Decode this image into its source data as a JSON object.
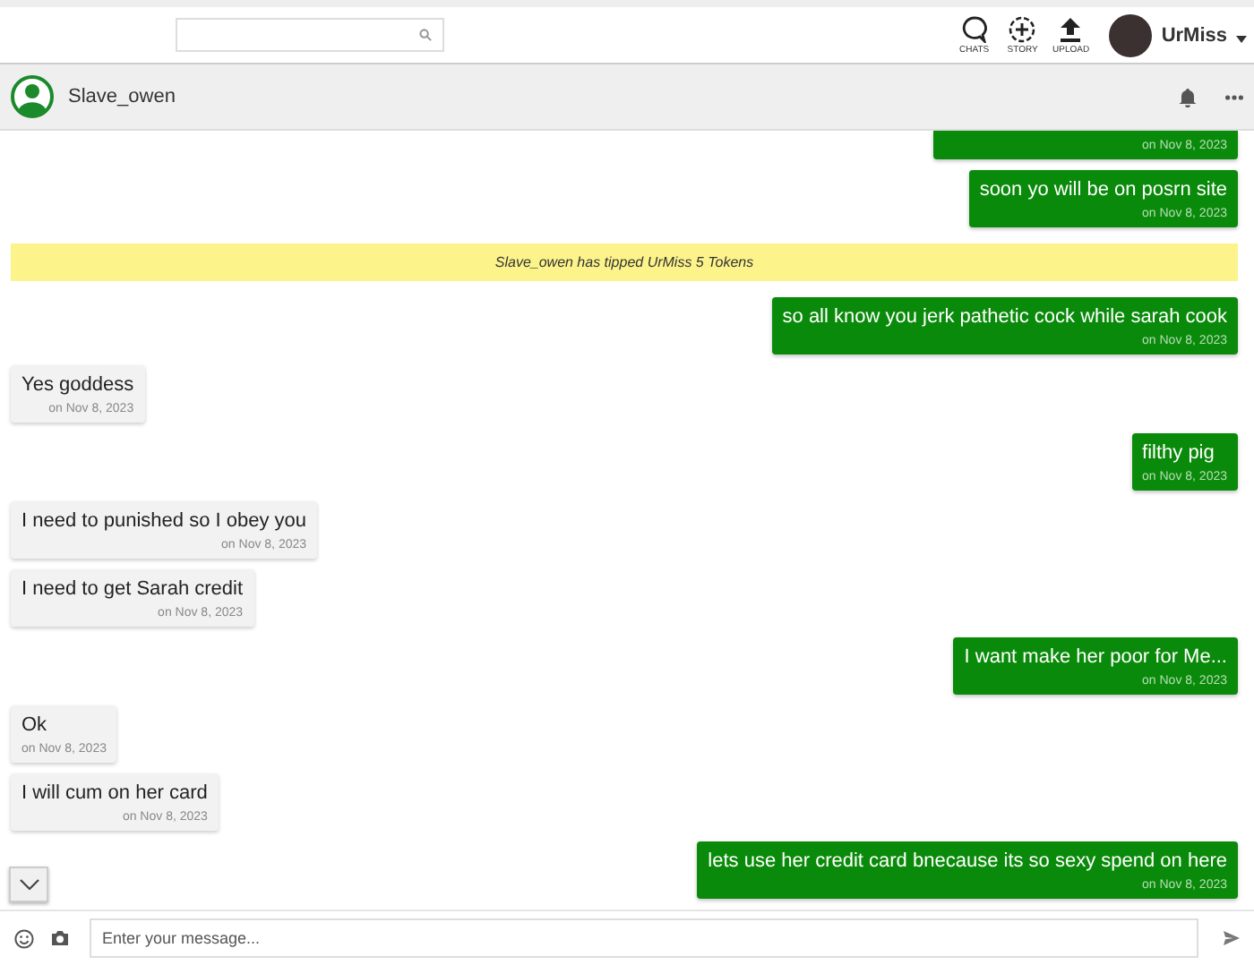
{
  "topbar": {
    "nav": [
      {
        "label": "CHATS",
        "kind": "chats"
      },
      {
        "label": "STORY",
        "kind": "story"
      },
      {
        "label": "UPLOAD",
        "kind": "upload"
      }
    ],
    "user": {
      "name": "UrMiss"
    }
  },
  "chat_header": {
    "name": "Slave_owen"
  },
  "messages": [
    {
      "kind": "sent",
      "time": "on Nov 8, 2023",
      "clipped": true
    },
    {
      "kind": "sent",
      "text": "soon yo will be on posrn site",
      "time": "on Nov 8, 2023"
    },
    {
      "kind": "tip",
      "text": "Slave_owen has tipped UrMiss 5 Tokens"
    },
    {
      "kind": "sent",
      "text": "so all know you jerk pathetic cock while sarah cook",
      "time": "on Nov 8, 2023"
    },
    {
      "kind": "received",
      "text": "Yes goddess",
      "time": "on Nov 8, 2023"
    },
    {
      "kind": "sent",
      "text": "filthy pig",
      "time": "on Nov 8, 2023"
    },
    {
      "kind": "received",
      "text": "I need to punished so I obey you",
      "time": "on Nov 8, 2023"
    },
    {
      "kind": "received",
      "text": "I need to get Sarah credit",
      "time": "on Nov 8, 2023"
    },
    {
      "kind": "sent",
      "text": "I want make her poor for Me...",
      "time": "on Nov 8, 2023"
    },
    {
      "kind": "received",
      "text": "Ok",
      "time": "on Nov 8, 2023"
    },
    {
      "kind": "received",
      "text": "I will cum on her card",
      "time": "on Nov 8, 2023"
    },
    {
      "kind": "sent",
      "text": "lets use her credit card bnecause its so sexy spend on here",
      "time": "on Nov 8, 2023"
    }
  ],
  "composer": {
    "placeholder": "Enter your message..."
  }
}
